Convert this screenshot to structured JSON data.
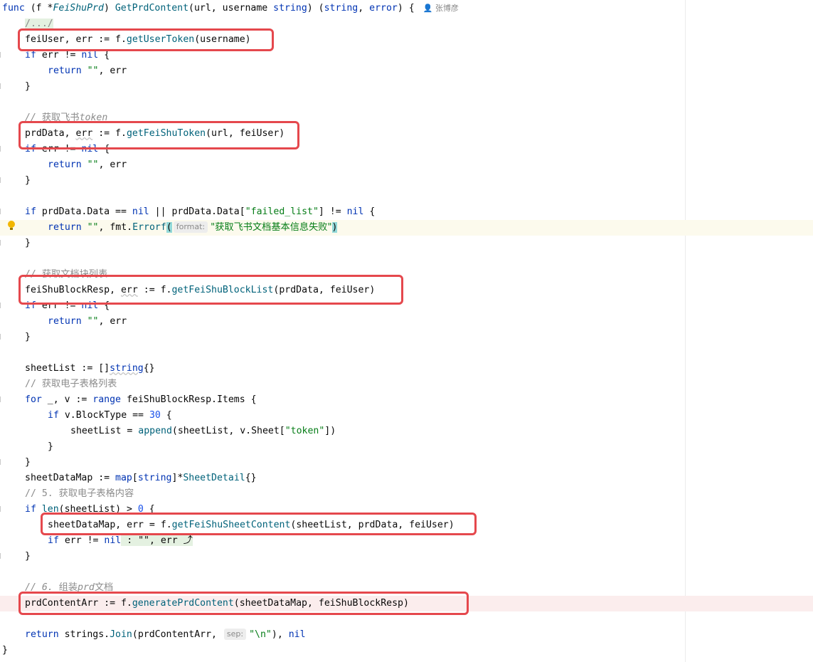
{
  "editor": {
    "author": "张博彦",
    "lines": {
      "sig_func": "func",
      "sig_open": " (f *",
      "sig_type": "FeiShuPrd",
      "sig_close": ") ",
      "sig_name": "GetPrdContent",
      "sig_params": "(url, username ",
      "sig_string": "string",
      "sig_ret_open": ") (",
      "sig_string2": "string",
      "sig_comma": ", ",
      "sig_error": "error",
      "sig_end": ") {",
      "fold": "/.../",
      "l3_a": "feiUser, err := f.",
      "l3_fn": "getUserToken",
      "l3_b": "(username)",
      "if": "if",
      "err_nil_a": " err != ",
      "nil": "nil",
      "brace_open": " {",
      "return": "return",
      "quotes": "\"\"",
      "ret_err": ", err",
      "brace_close": "}",
      "c1_slashes": "// ",
      "c1_text": "获取飞书",
      "c1_token": "token",
      "l8_a": "prdData, ",
      "l8_err": "err",
      "l8_b": " := f.",
      "l8_fn": "getFeiShuToken",
      "l8_c": "(url, feiUser)",
      "l13_a": " prdData.Data == ",
      "l13_b": " || prdData.Data[",
      "l13_str": "\"failed_list\"",
      "l13_c": "] != ",
      "l14_b": ", fmt.",
      "l14_fn": "Errorf",
      "l14_paren": "(",
      "l14_hint": "format:",
      "l14_str": "\"获取飞书文档基本信息失败\"",
      "l14_close": ")",
      "c2_text": "获取文档块列表",
      "l18_a": "feiShuBlockResp, ",
      "l18_fn": "getFeiShuBlockList",
      "l18_c": "(prdData, feiUser)",
      "l23_a": "sheetList := []",
      "l23_type": "string",
      "l23_b": "{}",
      "c3_text": "获取电子表格列表",
      "for": "for",
      "l25_a": " _, v := ",
      "range": "range",
      "l25_b": " feiShuBlockResp.Items {",
      "l26_a": " v.BlockType == ",
      "l26_num": "30",
      "l27_a": "sheetList = ",
      "l27_fn": "append",
      "l27_b": "(sheetList, v.Sheet[",
      "l27_str": "\"token\"",
      "l27_c": "])",
      "l30_a": "sheetDataMap := ",
      "map": "map",
      "l30_b": "[",
      "l30_c": "]*",
      "l30_type": "SheetDetail",
      "l30_d": "{}",
      "c4_num": "5.",
      "c4_text": "获取电子表格内容",
      "l32_fn": "len",
      "l32_a": "(sheetList) > ",
      "l32_num": "0",
      "l33_a": "sheetDataMap, err = f.",
      "l33_fn": "getFeiShuSheetContent",
      "l33_b": "(sheetList, prdData, feiUser)",
      "l34_fold": " : \"\", err ⤴",
      "c5_num": "6.",
      "c5_text": "组装",
      "c5_prd": "prd",
      "c5_text2": "文档",
      "l38_a": "prdContentArr := f.",
      "l38_fn": "generatePrdContent",
      "l38_b": "(sheetDataMap, feiShuBlockResp)",
      "l40_a": " strings.",
      "l40_fn": "Join",
      "l40_b": "(prdContentArr, ",
      "l40_hint": "sep:",
      "l40_str": "\"\\n\"",
      "l40_c": "), "
    }
  }
}
